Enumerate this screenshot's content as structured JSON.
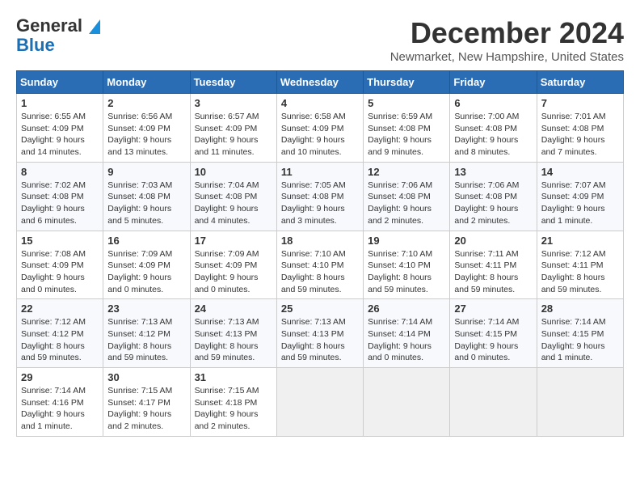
{
  "header": {
    "logo_line1": "General",
    "logo_line2": "Blue",
    "month_title": "December 2024",
    "location": "Newmarket, New Hampshire, United States"
  },
  "weekdays": [
    "Sunday",
    "Monday",
    "Tuesday",
    "Wednesday",
    "Thursday",
    "Friday",
    "Saturday"
  ],
  "weeks": [
    [
      {
        "day": "1",
        "sunrise": "6:55 AM",
        "sunset": "4:09 PM",
        "daylight": "9 hours and 14 minutes."
      },
      {
        "day": "2",
        "sunrise": "6:56 AM",
        "sunset": "4:09 PM",
        "daylight": "9 hours and 13 minutes."
      },
      {
        "day": "3",
        "sunrise": "6:57 AM",
        "sunset": "4:09 PM",
        "daylight": "9 hours and 11 minutes."
      },
      {
        "day": "4",
        "sunrise": "6:58 AM",
        "sunset": "4:09 PM",
        "daylight": "9 hours and 10 minutes."
      },
      {
        "day": "5",
        "sunrise": "6:59 AM",
        "sunset": "4:08 PM",
        "daylight": "9 hours and 9 minutes."
      },
      {
        "day": "6",
        "sunrise": "7:00 AM",
        "sunset": "4:08 PM",
        "daylight": "9 hours and 8 minutes."
      },
      {
        "day": "7",
        "sunrise": "7:01 AM",
        "sunset": "4:08 PM",
        "daylight": "9 hours and 7 minutes."
      }
    ],
    [
      {
        "day": "8",
        "sunrise": "7:02 AM",
        "sunset": "4:08 PM",
        "daylight": "9 hours and 6 minutes."
      },
      {
        "day": "9",
        "sunrise": "7:03 AM",
        "sunset": "4:08 PM",
        "daylight": "9 hours and 5 minutes."
      },
      {
        "day": "10",
        "sunrise": "7:04 AM",
        "sunset": "4:08 PM",
        "daylight": "9 hours and 4 minutes."
      },
      {
        "day": "11",
        "sunrise": "7:05 AM",
        "sunset": "4:08 PM",
        "daylight": "9 hours and 3 minutes."
      },
      {
        "day": "12",
        "sunrise": "7:06 AM",
        "sunset": "4:08 PM",
        "daylight": "9 hours and 2 minutes."
      },
      {
        "day": "13",
        "sunrise": "7:06 AM",
        "sunset": "4:08 PM",
        "daylight": "9 hours and 2 minutes."
      },
      {
        "day": "14",
        "sunrise": "7:07 AM",
        "sunset": "4:09 PM",
        "daylight": "9 hours and 1 minute."
      }
    ],
    [
      {
        "day": "15",
        "sunrise": "7:08 AM",
        "sunset": "4:09 PM",
        "daylight": "9 hours and 0 minutes."
      },
      {
        "day": "16",
        "sunrise": "7:09 AM",
        "sunset": "4:09 PM",
        "daylight": "9 hours and 0 minutes."
      },
      {
        "day": "17",
        "sunrise": "7:09 AM",
        "sunset": "4:09 PM",
        "daylight": "9 hours and 0 minutes."
      },
      {
        "day": "18",
        "sunrise": "7:10 AM",
        "sunset": "4:10 PM",
        "daylight": "8 hours and 59 minutes."
      },
      {
        "day": "19",
        "sunrise": "7:10 AM",
        "sunset": "4:10 PM",
        "daylight": "8 hours and 59 minutes."
      },
      {
        "day": "20",
        "sunrise": "7:11 AM",
        "sunset": "4:11 PM",
        "daylight": "8 hours and 59 minutes."
      },
      {
        "day": "21",
        "sunrise": "7:12 AM",
        "sunset": "4:11 PM",
        "daylight": "8 hours and 59 minutes."
      }
    ],
    [
      {
        "day": "22",
        "sunrise": "7:12 AM",
        "sunset": "4:12 PM",
        "daylight": "8 hours and 59 minutes."
      },
      {
        "day": "23",
        "sunrise": "7:13 AM",
        "sunset": "4:12 PM",
        "daylight": "8 hours and 59 minutes."
      },
      {
        "day": "24",
        "sunrise": "7:13 AM",
        "sunset": "4:13 PM",
        "daylight": "8 hours and 59 minutes."
      },
      {
        "day": "25",
        "sunrise": "7:13 AM",
        "sunset": "4:13 PM",
        "daylight": "8 hours and 59 minutes."
      },
      {
        "day": "26",
        "sunrise": "7:14 AM",
        "sunset": "4:14 PM",
        "daylight": "9 hours and 0 minutes."
      },
      {
        "day": "27",
        "sunrise": "7:14 AM",
        "sunset": "4:15 PM",
        "daylight": "9 hours and 0 minutes."
      },
      {
        "day": "28",
        "sunrise": "7:14 AM",
        "sunset": "4:15 PM",
        "daylight": "9 hours and 1 minute."
      }
    ],
    [
      {
        "day": "29",
        "sunrise": "7:14 AM",
        "sunset": "4:16 PM",
        "daylight": "9 hours and 1 minute."
      },
      {
        "day": "30",
        "sunrise": "7:15 AM",
        "sunset": "4:17 PM",
        "daylight": "9 hours and 2 minutes."
      },
      {
        "day": "31",
        "sunrise": "7:15 AM",
        "sunset": "4:18 PM",
        "daylight": "9 hours and 2 minutes."
      },
      null,
      null,
      null,
      null
    ]
  ]
}
